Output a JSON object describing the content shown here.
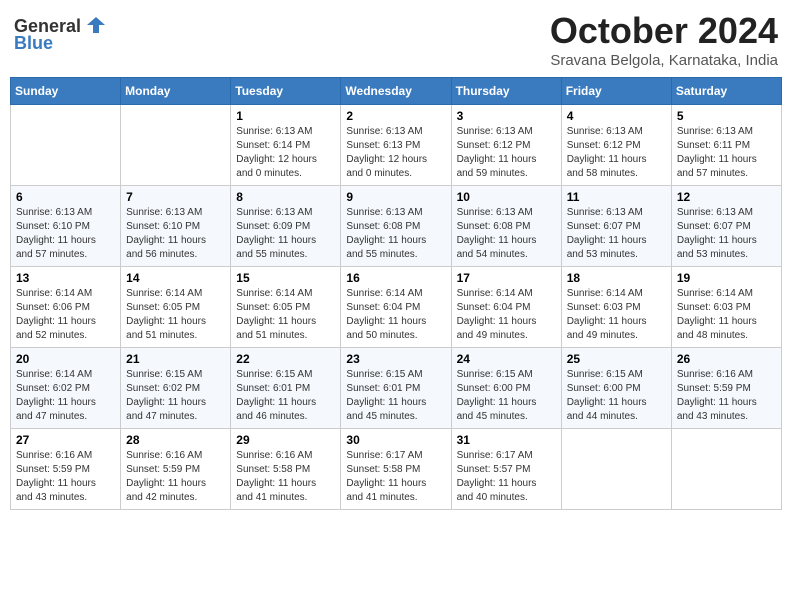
{
  "header": {
    "logo_general": "General",
    "logo_blue": "Blue",
    "month_title": "October 2024",
    "location": "Sravana Belgola, Karnataka, India"
  },
  "days_of_week": [
    "Sunday",
    "Monday",
    "Tuesday",
    "Wednesday",
    "Thursday",
    "Friday",
    "Saturday"
  ],
  "weeks": [
    [
      {
        "day": "",
        "info": ""
      },
      {
        "day": "",
        "info": ""
      },
      {
        "day": "1",
        "info": "Sunrise: 6:13 AM\nSunset: 6:14 PM\nDaylight: 12 hours\nand 0 minutes."
      },
      {
        "day": "2",
        "info": "Sunrise: 6:13 AM\nSunset: 6:13 PM\nDaylight: 12 hours\nand 0 minutes."
      },
      {
        "day": "3",
        "info": "Sunrise: 6:13 AM\nSunset: 6:12 PM\nDaylight: 11 hours\nand 59 minutes."
      },
      {
        "day": "4",
        "info": "Sunrise: 6:13 AM\nSunset: 6:12 PM\nDaylight: 11 hours\nand 58 minutes."
      },
      {
        "day": "5",
        "info": "Sunrise: 6:13 AM\nSunset: 6:11 PM\nDaylight: 11 hours\nand 57 minutes."
      }
    ],
    [
      {
        "day": "6",
        "info": "Sunrise: 6:13 AM\nSunset: 6:10 PM\nDaylight: 11 hours\nand 57 minutes."
      },
      {
        "day": "7",
        "info": "Sunrise: 6:13 AM\nSunset: 6:10 PM\nDaylight: 11 hours\nand 56 minutes."
      },
      {
        "day": "8",
        "info": "Sunrise: 6:13 AM\nSunset: 6:09 PM\nDaylight: 11 hours\nand 55 minutes."
      },
      {
        "day": "9",
        "info": "Sunrise: 6:13 AM\nSunset: 6:08 PM\nDaylight: 11 hours\nand 55 minutes."
      },
      {
        "day": "10",
        "info": "Sunrise: 6:13 AM\nSunset: 6:08 PM\nDaylight: 11 hours\nand 54 minutes."
      },
      {
        "day": "11",
        "info": "Sunrise: 6:13 AM\nSunset: 6:07 PM\nDaylight: 11 hours\nand 53 minutes."
      },
      {
        "day": "12",
        "info": "Sunrise: 6:13 AM\nSunset: 6:07 PM\nDaylight: 11 hours\nand 53 minutes."
      }
    ],
    [
      {
        "day": "13",
        "info": "Sunrise: 6:14 AM\nSunset: 6:06 PM\nDaylight: 11 hours\nand 52 minutes."
      },
      {
        "day": "14",
        "info": "Sunrise: 6:14 AM\nSunset: 6:05 PM\nDaylight: 11 hours\nand 51 minutes."
      },
      {
        "day": "15",
        "info": "Sunrise: 6:14 AM\nSunset: 6:05 PM\nDaylight: 11 hours\nand 51 minutes."
      },
      {
        "day": "16",
        "info": "Sunrise: 6:14 AM\nSunset: 6:04 PM\nDaylight: 11 hours\nand 50 minutes."
      },
      {
        "day": "17",
        "info": "Sunrise: 6:14 AM\nSunset: 6:04 PM\nDaylight: 11 hours\nand 49 minutes."
      },
      {
        "day": "18",
        "info": "Sunrise: 6:14 AM\nSunset: 6:03 PM\nDaylight: 11 hours\nand 49 minutes."
      },
      {
        "day": "19",
        "info": "Sunrise: 6:14 AM\nSunset: 6:03 PM\nDaylight: 11 hours\nand 48 minutes."
      }
    ],
    [
      {
        "day": "20",
        "info": "Sunrise: 6:14 AM\nSunset: 6:02 PM\nDaylight: 11 hours\nand 47 minutes."
      },
      {
        "day": "21",
        "info": "Sunrise: 6:15 AM\nSunset: 6:02 PM\nDaylight: 11 hours\nand 47 minutes."
      },
      {
        "day": "22",
        "info": "Sunrise: 6:15 AM\nSunset: 6:01 PM\nDaylight: 11 hours\nand 46 minutes."
      },
      {
        "day": "23",
        "info": "Sunrise: 6:15 AM\nSunset: 6:01 PM\nDaylight: 11 hours\nand 45 minutes."
      },
      {
        "day": "24",
        "info": "Sunrise: 6:15 AM\nSunset: 6:00 PM\nDaylight: 11 hours\nand 45 minutes."
      },
      {
        "day": "25",
        "info": "Sunrise: 6:15 AM\nSunset: 6:00 PM\nDaylight: 11 hours\nand 44 minutes."
      },
      {
        "day": "26",
        "info": "Sunrise: 6:16 AM\nSunset: 5:59 PM\nDaylight: 11 hours\nand 43 minutes."
      }
    ],
    [
      {
        "day": "27",
        "info": "Sunrise: 6:16 AM\nSunset: 5:59 PM\nDaylight: 11 hours\nand 43 minutes."
      },
      {
        "day": "28",
        "info": "Sunrise: 6:16 AM\nSunset: 5:59 PM\nDaylight: 11 hours\nand 42 minutes."
      },
      {
        "day": "29",
        "info": "Sunrise: 6:16 AM\nSunset: 5:58 PM\nDaylight: 11 hours\nand 41 minutes."
      },
      {
        "day": "30",
        "info": "Sunrise: 6:17 AM\nSunset: 5:58 PM\nDaylight: 11 hours\nand 41 minutes."
      },
      {
        "day": "31",
        "info": "Sunrise: 6:17 AM\nSunset: 5:57 PM\nDaylight: 11 hours\nand 40 minutes."
      },
      {
        "day": "",
        "info": ""
      },
      {
        "day": "",
        "info": ""
      }
    ]
  ]
}
